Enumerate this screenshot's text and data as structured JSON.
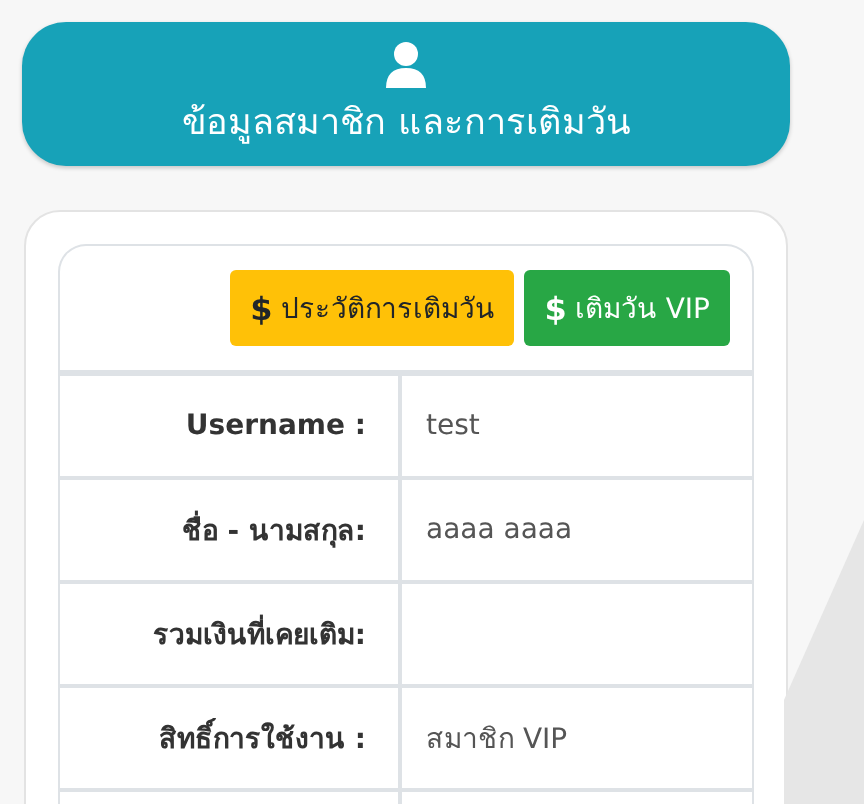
{
  "header": {
    "title": "ข้อมูลสมาชิก และการเติมวัน"
  },
  "buttons": [
    {
      "icon": "$",
      "label": "ประวัติการเติมวัน",
      "kind": "warning"
    },
    {
      "icon": "$",
      "label": "เติมวัน VIP",
      "kind": "success"
    }
  ],
  "rows": [
    {
      "label": "Username :",
      "value": "test"
    },
    {
      "label": "ชื่อ - นามสกุล:",
      "value": "aaaa aaaa"
    },
    {
      "label": "รวมเงินที่เคยเติม:"
    },
    {
      "label": "สิทธิ์การใช้งาน :",
      "value": "สมาชิก VIP"
    },
    {}
  ]
}
